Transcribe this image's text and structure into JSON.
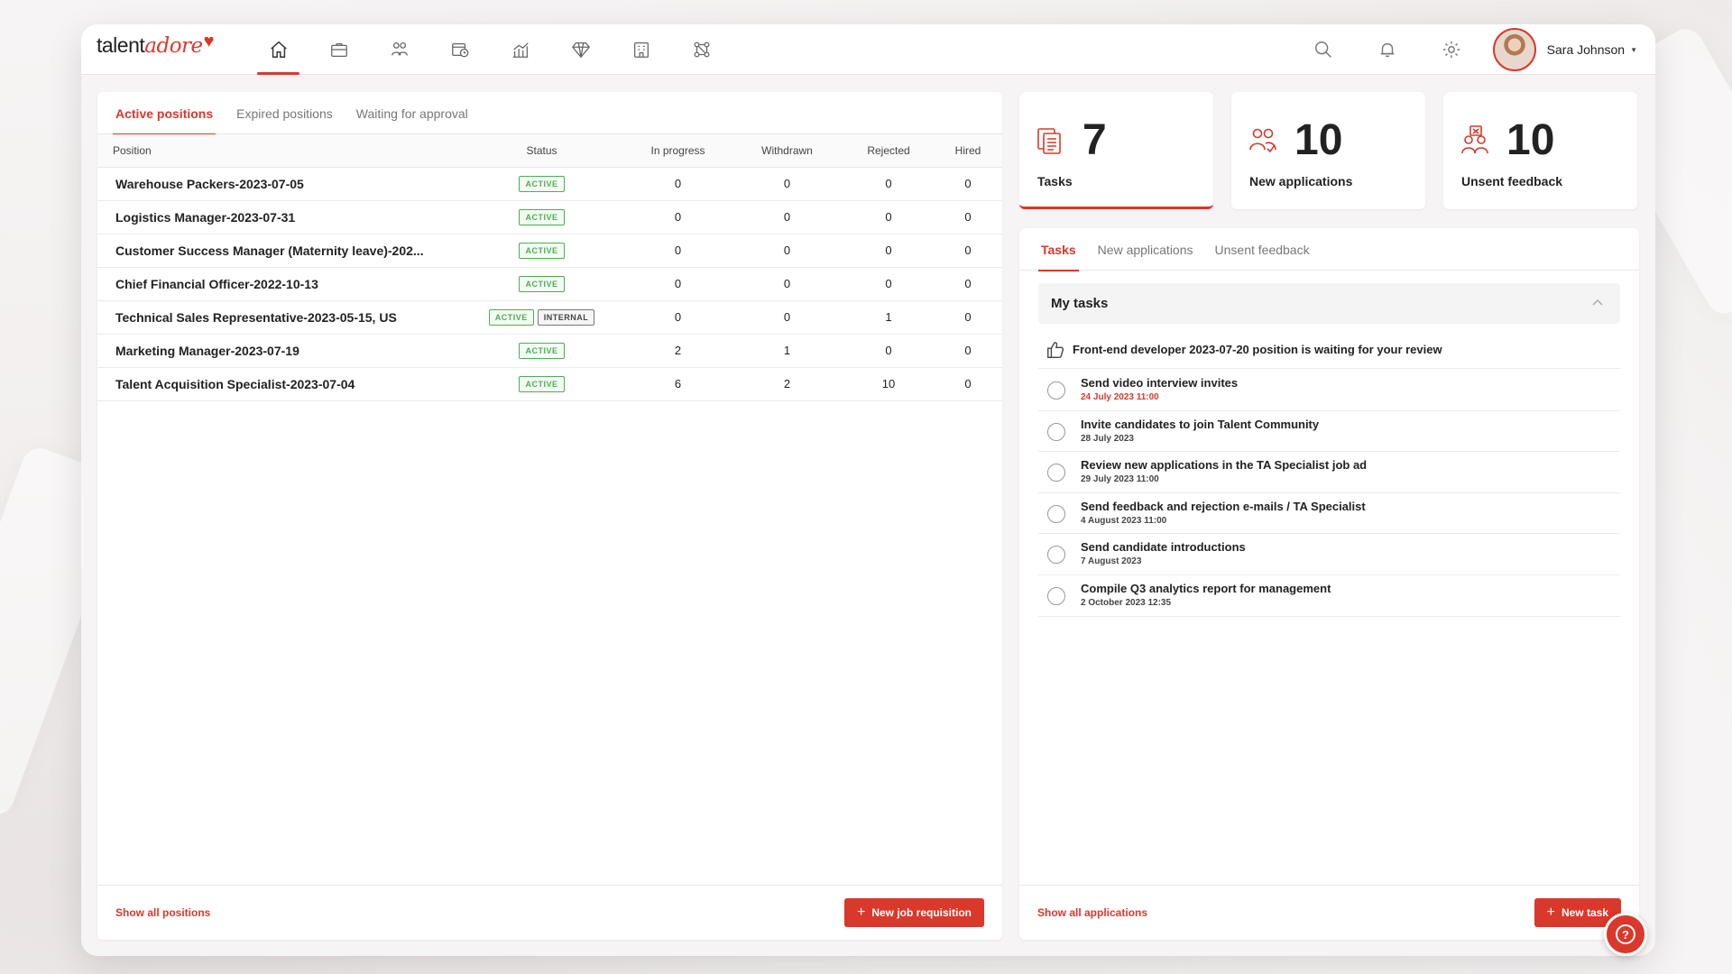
{
  "brand": {
    "logo_part1": "talent",
    "logo_part2": "adore",
    "accent_color": "#d9382b"
  },
  "nav": {
    "items": [
      {
        "icon": "home-icon",
        "active": true
      },
      {
        "icon": "briefcase-icon",
        "active": false
      },
      {
        "icon": "candidates-icon",
        "active": false
      },
      {
        "icon": "calendar-clock-icon",
        "active": false
      },
      {
        "icon": "analytics-icon",
        "active": false
      },
      {
        "icon": "diamond-icon",
        "active": false
      },
      {
        "icon": "building-icon",
        "active": false
      },
      {
        "icon": "integrations-icon",
        "active": false
      }
    ]
  },
  "header": {
    "user_name": "Sara Johnson"
  },
  "positions_panel": {
    "tabs": [
      "Active positions",
      "Expired positions",
      "Waiting for approval"
    ],
    "columns": [
      "Position",
      "Status",
      "In progress",
      "Withdrawn",
      "Rejected",
      "Hired"
    ],
    "rows": [
      {
        "name": "Warehouse Packers-2023-07-05",
        "badges": [
          "ACTIVE"
        ],
        "in_progress": "0",
        "withdrawn": "0",
        "rejected": "0",
        "hired": "0"
      },
      {
        "name": "Logistics Manager-2023-07-31",
        "badges": [
          "ACTIVE"
        ],
        "in_progress": "0",
        "withdrawn": "0",
        "rejected": "0",
        "hired": "0"
      },
      {
        "name": "Customer Success Manager (Maternity leave)-202...",
        "badges": [
          "ACTIVE"
        ],
        "in_progress": "0",
        "withdrawn": "0",
        "rejected": "0",
        "hired": "0"
      },
      {
        "name": "Chief Financial Officer-2022-10-13",
        "badges": [
          "ACTIVE"
        ],
        "in_progress": "0",
        "withdrawn": "0",
        "rejected": "0",
        "hired": "0"
      },
      {
        "name": "Technical Sales Representative-2023-05-15, US",
        "badges": [
          "ACTIVE",
          "INTERNAL"
        ],
        "in_progress": "0",
        "withdrawn": "0",
        "rejected": "1",
        "hired": "0"
      },
      {
        "name": "Marketing Manager-2023-07-19",
        "badges": [
          "ACTIVE"
        ],
        "in_progress": "2",
        "withdrawn": "1",
        "rejected": "0",
        "hired": "0"
      },
      {
        "name": "Talent Acquisition Specialist-2023-07-04",
        "badges": [
          "ACTIVE"
        ],
        "in_progress": "6",
        "withdrawn": "2",
        "rejected": "10",
        "hired": "0"
      }
    ],
    "show_all_label": "Show all positions",
    "new_button_label": "New job requisition"
  },
  "stats": [
    {
      "value": "7",
      "label": "Tasks",
      "icon": "tasks-icon"
    },
    {
      "value": "10",
      "label": "New applications",
      "icon": "new-applications-icon"
    },
    {
      "value": "10",
      "label": "Unsent feedback",
      "icon": "unsent-feedback-icon"
    }
  ],
  "tasks_panel": {
    "tabs": [
      "Tasks",
      "New applications",
      "Unsent feedback"
    ],
    "section_title": "My tasks",
    "notice": "Front-end developer 2023-07-20 position is waiting for your review",
    "tasks": [
      {
        "title": "Send video interview invites",
        "date": "24 July 2023 11:00",
        "overdue": true
      },
      {
        "title": "Invite candidates to join Talent Community",
        "date": "28 July 2023",
        "overdue": false
      },
      {
        "title": "Review new applications in the TA Specialist job ad",
        "date": "29 July 2023 11:00",
        "overdue": false
      },
      {
        "title": "Send feedback and rejection e-mails / TA Specialist",
        "date": "4 August 2023 11:00",
        "overdue": false
      },
      {
        "title": "Send candidate introductions",
        "date": "7 August 2023",
        "overdue": false
      },
      {
        "title": "Compile Q3 analytics report for management",
        "date": "2 October 2023 12:35",
        "overdue": false
      }
    ],
    "show_all_label": "Show all applications",
    "new_button_label": "New task"
  },
  "help": {
    "icon": "help-icon"
  }
}
